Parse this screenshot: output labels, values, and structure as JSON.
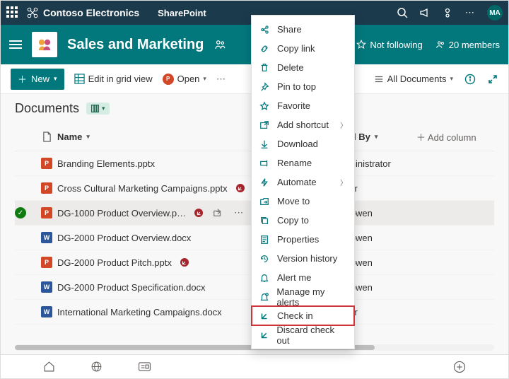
{
  "suite": {
    "brand": "Contoso Electronics",
    "app": "SharePoint",
    "avatar": "MA"
  },
  "site": {
    "title": "Sales and Marketing",
    "follow": "Not following",
    "members": "20 members"
  },
  "cmd": {
    "new": "New",
    "editGrid": "Edit in grid view",
    "open": "Open",
    "viewName": "All Documents"
  },
  "lib": {
    "title": "Documents"
  },
  "cols": {
    "name": "Name",
    "modBy": "dified By",
    "add": "Add column"
  },
  "rows": [
    {
      "icon": "ppt",
      "name": "Branding Elements.pptx",
      "co": false,
      "modBy": ") Administrator",
      "sel": false
    },
    {
      "icon": "ppt",
      "name": "Cross Cultural Marketing Campaigns.pptx",
      "co": true,
      "modBy": "Wilber",
      "sel": false
    },
    {
      "icon": "ppt",
      "name": "DG-1000 Product Overview.p…",
      "co": true,
      "modBy": "an Bowen",
      "sel": true
    },
    {
      "icon": "docx",
      "name": "DG-2000 Product Overview.docx",
      "co": false,
      "modBy": "an Bowen",
      "sel": false
    },
    {
      "icon": "ppt",
      "name": "DG-2000 Product Pitch.pptx",
      "co": true,
      "modBy": "an Bowen",
      "sel": false
    },
    {
      "icon": "docx",
      "name": "DG-2000 Product Specification.docx",
      "co": false,
      "modBy": "an Bowen",
      "sel": false
    },
    {
      "icon": "docx",
      "name": "International Marketing Campaigns.docx",
      "co": false,
      "modBy": "Wilber",
      "sel": false
    }
  ],
  "ctx": [
    {
      "icon": "share",
      "label": "Share"
    },
    {
      "icon": "link",
      "label": "Copy link"
    },
    {
      "icon": "trash",
      "label": "Delete"
    },
    {
      "icon": "pin",
      "label": "Pin to top"
    },
    {
      "icon": "star",
      "label": "Favorite"
    },
    {
      "icon": "shortcut",
      "label": "Add shortcut",
      "sub": true
    },
    {
      "icon": "download",
      "label": "Download"
    },
    {
      "icon": "rename",
      "label": "Rename"
    },
    {
      "icon": "automate",
      "label": "Automate",
      "sub": true
    },
    {
      "icon": "move",
      "label": "Move to"
    },
    {
      "icon": "copy",
      "label": "Copy to"
    },
    {
      "icon": "props",
      "label": "Properties"
    },
    {
      "icon": "history",
      "label": "Version history"
    },
    {
      "icon": "alert",
      "label": "Alert me"
    },
    {
      "icon": "alerts",
      "label": "Manage my alerts"
    },
    {
      "icon": "checkin",
      "label": "Check in",
      "hi": true
    },
    {
      "icon": "discard",
      "label": "Discard check out"
    }
  ]
}
